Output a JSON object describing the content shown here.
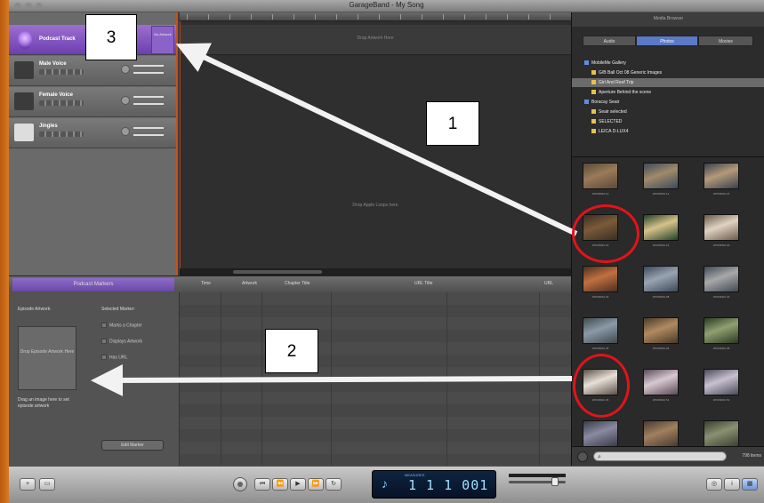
{
  "window": {
    "title": "GarageBand - My Song"
  },
  "tracks": [
    {
      "name": "Podcast Track",
      "kind": "podcast"
    },
    {
      "name": "Male Voice",
      "kind": "voice"
    },
    {
      "name": "Female Voice",
      "kind": "voice"
    },
    {
      "name": "Jingles",
      "kind": "jingle"
    }
  ],
  "podcast_side_label": "No Artwork",
  "timeline": {
    "drop_hint_top": "Drop Artwork Here",
    "drop_hint_center": "Drop Apple Loops here"
  },
  "media_browser": {
    "header": "Media Browser",
    "tabs": [
      "Audio",
      "Photos",
      "Movies"
    ],
    "selected_tab": "Photos",
    "tree": [
      {
        "label": "MobileMe Gallery",
        "level": 0,
        "selected": false
      },
      {
        "label": "G/B Ball Oct 08 Generic Images",
        "level": 1,
        "selected": false
      },
      {
        "label": "Girl And Reef Trip",
        "level": 1,
        "selected": true
      },
      {
        "label": "Aperture Behind the scene",
        "level": 1,
        "selected": false
      },
      {
        "label": "Boracay Seair",
        "level": 0,
        "selected": false
      },
      {
        "label": "Seair selected",
        "level": 1,
        "selected": false
      },
      {
        "label": "SELECTED",
        "level": 1,
        "selected": false
      },
      {
        "label": "LEICA D-LUX4",
        "level": 1,
        "selected": false
      }
    ],
    "photos": [
      {
        "caption": "JPKD9901 10",
        "tone": "#5a4a38",
        "accent": "#9a7a5a",
        "highlighted": false
      },
      {
        "caption": "JPKD9901 12",
        "tone": "#3c4a5a",
        "accent": "#a08a6a",
        "highlighted": false
      },
      {
        "caption": "JPKD9901 15",
        "tone": "#3a3f4f",
        "accent": "#b39a7a",
        "highlighted": false
      },
      {
        "caption": "JPKD9901 16",
        "tone": "#3a2e22",
        "accent": "#7a5a3a",
        "highlighted": true
      },
      {
        "caption": "JPKD9901 19",
        "tone": "#24402a",
        "accent": "#d7c28a",
        "highlighted": false
      },
      {
        "caption": "JPKD9901 40",
        "tone": "#6a5a4a",
        "accent": "#e0d2c0",
        "highlighted": false
      },
      {
        "caption": "JPKD9901 23",
        "tone": "#4a3020",
        "accent": "#c07040",
        "highlighted": false
      },
      {
        "caption": "JPKD9901 28",
        "tone": "#3a4a5a",
        "accent": "#9aa4b0",
        "highlighted": false
      },
      {
        "caption": "JPKD9901 32",
        "tone": "#3f4a55",
        "accent": "#a8a8a8",
        "highlighted": false
      },
      {
        "caption": "JPKD9901 35",
        "tone": "#3f4a4f",
        "accent": "#8a9aa6",
        "highlighted": false
      },
      {
        "caption": "JPKD9901 36",
        "tone": "#4a3a2a",
        "accent": "#b08a60",
        "highlighted": false
      },
      {
        "caption": "JPKD9901 38",
        "tone": "#2a3a22",
        "accent": "#90a070",
        "highlighted": false
      },
      {
        "caption": "JPKD9901 45",
        "tone": "#5a5048",
        "accent": "#e8e0d8",
        "highlighted": true
      },
      {
        "caption": "JPKD9901 51",
        "tone": "#5a4a58",
        "accent": "#d8c8d0",
        "highlighted": false
      },
      {
        "caption": "JPKD9901 52",
        "tone": "#4a4a5a",
        "accent": "#c8c0d0",
        "highlighted": false
      },
      {
        "caption": "",
        "tone": "#3a3a4a",
        "accent": "#8a8aa0",
        "highlighted": false
      },
      {
        "caption": "",
        "tone": "#4a3a30",
        "accent": "#a08060",
        "highlighted": false
      },
      {
        "caption": "",
        "tone": "#3a4030",
        "accent": "#8a9070",
        "highlighted": false
      }
    ],
    "search_placeholder": "",
    "item_count": "798 items"
  },
  "editor": {
    "tab_label": "Podcast Markers",
    "columns": [
      "Time",
      "Artwork",
      "Chapter Title",
      "URL Title",
      "URL"
    ],
    "episode_artwork_label": "Episode Artwork:",
    "artwork_well_text": "Drop Episode Artwork Here",
    "artwork_hint": "Drag an image here to set episode artwork",
    "marker_region_label": "Selected Marker:",
    "checks": [
      "Marks a Chapter",
      "Displays Artwork",
      "Has URL"
    ],
    "edit_button": "Edit Marker"
  },
  "transport": {
    "lcd_mode": "MEASURES",
    "lcd_value": "1 1 1 001"
  },
  "annotations": [
    {
      "label": "1"
    },
    {
      "label": "2"
    },
    {
      "label": "3"
    }
  ],
  "colors": {
    "podcast_purple": "#7a4fc0",
    "playhead": "#c85018",
    "annotation_red": "#e3131a",
    "arrow_white": "#f2f2f2"
  }
}
